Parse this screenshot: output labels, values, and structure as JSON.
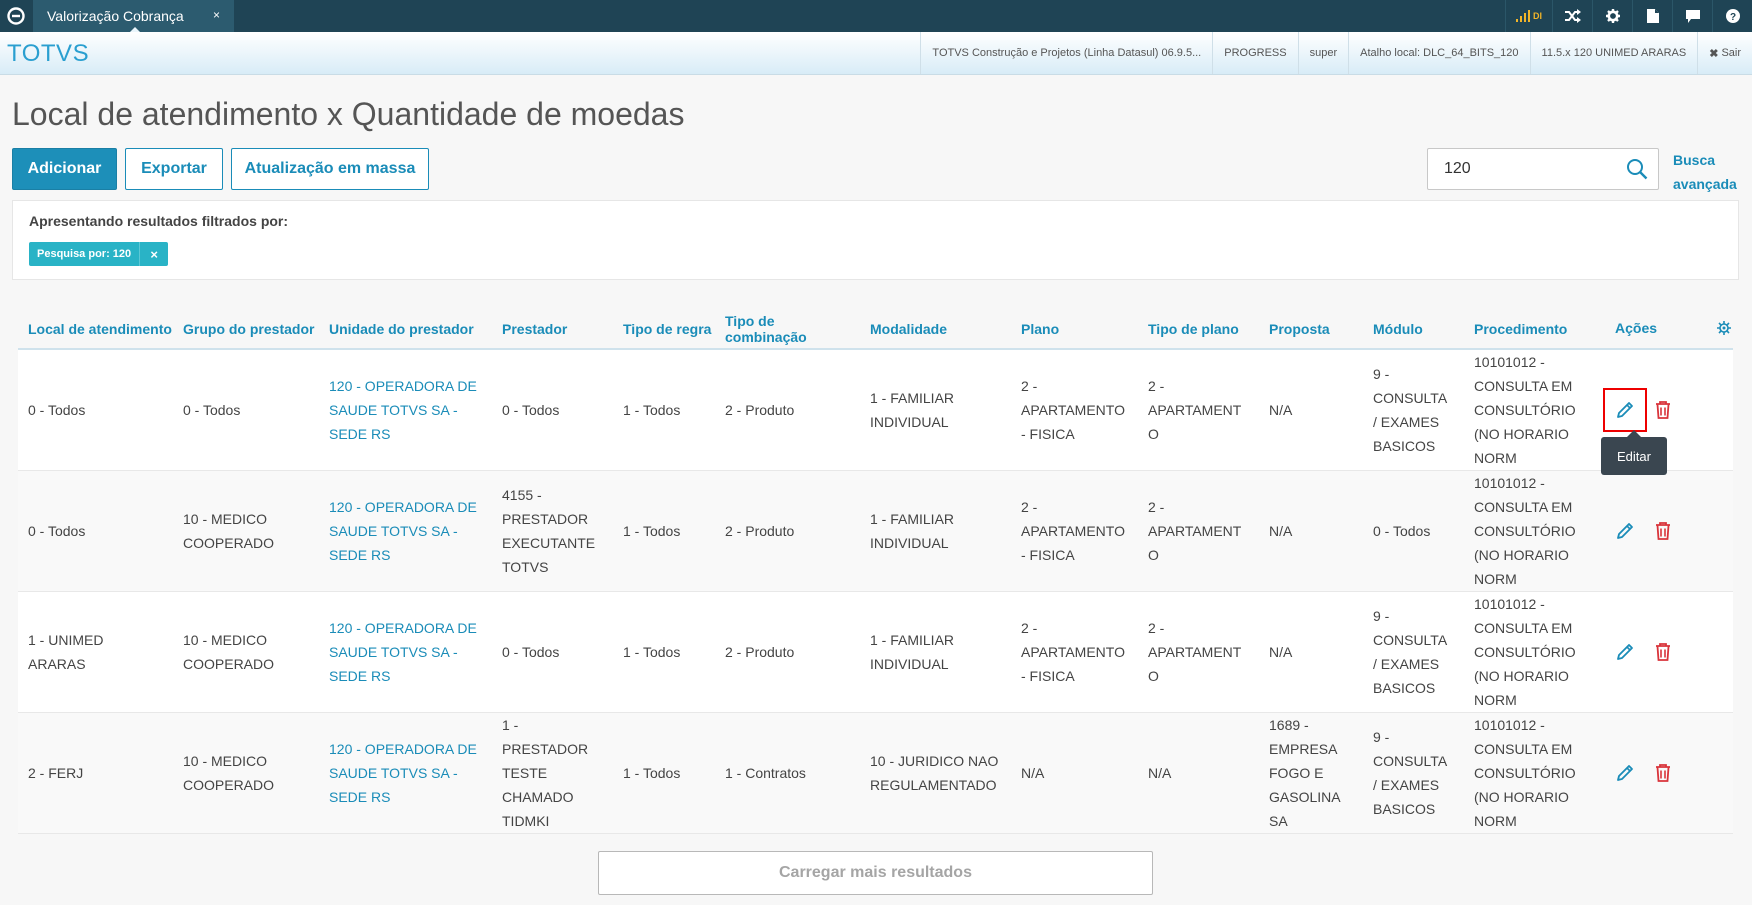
{
  "topbar": {
    "tab_label": "Valorização Cobrança",
    "tab_close": "×",
    "signal_text": "DI"
  },
  "header": {
    "brand": "TOTVS",
    "info": [
      "TOTVS Construção e Projetos (Linha Datasul) 06.9.5...",
      "PROGRESS",
      "super",
      "Atalho local: DLC_64_BITS_120",
      "11.5.x 120 UNIMED ARARAS"
    ],
    "logout": "Sair"
  },
  "page": {
    "title": "Local de atendimento x Quantidade de moedas"
  },
  "toolbar": {
    "add_label": "Adicionar",
    "export_label": "Exportar",
    "mass_update_label": "Atualização em massa",
    "search_value": "120",
    "advanced_search_label": "Busca avançada"
  },
  "filter": {
    "label": "Apresentando resultados filtrados por:",
    "chip_label": "Pesquisa por: 120",
    "chip_close": "×"
  },
  "table": {
    "columns": [
      "Local de atendimento",
      "Grupo do prestador",
      "Unidade do prestador",
      "Prestador",
      "Tipo de regra",
      "Tipo de combinação",
      "Modalidade",
      "Plano",
      "Tipo de plano",
      "Proposta",
      "Módulo",
      "Procedimento",
      "Ações"
    ],
    "rows": [
      [
        "0 - Todos",
        "0 - Todos",
        "120 - OPERADORA DE SAUDE TOTVS SA - SEDE RS",
        "0 - Todos",
        "1 - Todos",
        "2 - Produto",
        "1 - FAMILIAR INDIVIDUAL",
        "2 - APARTAMENTO - FISICA",
        "2 - APARTAMENTO",
        "N/A",
        "9 - CONSULTA / EXAMES BASICOS",
        "10101012 - CONSULTA EM CONSULTÓRIO (NO HORARIO NORM"
      ],
      [
        "0 - Todos",
        "10 - MEDICO COOPERADO",
        "120 - OPERADORA DE SAUDE TOTVS SA - SEDE RS",
        "4155 - PRESTADOR EXECUTANTE TOTVS",
        "1 - Todos",
        "2 - Produto",
        "1 - FAMILIAR INDIVIDUAL",
        "2 - APARTAMENTO - FISICA",
        "2 - APARTAMENTO",
        "N/A",
        "0 - Todos",
        "10101012 - CONSULTA EM CONSULTÓRIO (NO HORARIO NORM"
      ],
      [
        "1 - UNIMED ARARAS",
        "10 - MEDICO COOPERADO",
        "120 - OPERADORA DE SAUDE TOTVS SA - SEDE RS",
        "0 - Todos",
        "1 - Todos",
        "2 - Produto",
        "1 - FAMILIAR INDIVIDUAL",
        "2 - APARTAMENTO - FISICA",
        "2 - APARTAMENTO",
        "N/A",
        "9 - CONSULTA / EXAMES BASICOS",
        "10101012 - CONSULTA EM CONSULTÓRIO (NO HORARIO NORM"
      ],
      [
        "2 - FERJ",
        "10 - MEDICO COOPERADO",
        "120 - OPERADORA DE SAUDE TOTVS SA - SEDE RS",
        "1 - PRESTADOR TESTE CHAMADO TIDMKI",
        "1 - Todos",
        "1 - Contratos",
        "10 - JURIDICO NAO REGULAMENTADO",
        "N/A",
        "N/A",
        "1689 - EMPRESA FOGO E GASOLINA SA",
        "9 - CONSULTA / EXAMES BASICOS",
        "10101012 - CONSULTA EM CONSULTÓRIO (NO HORARIO NORM"
      ]
    ],
    "tooltip": "Editar",
    "load_more": "Carregar mais resultados"
  },
  "colors": {
    "topbar": "#1f4455",
    "accent": "#1a8cb8",
    "primary_button": "#1d8fb9",
    "chip": "#29b3c6",
    "delete": "#d9343b",
    "highlight": "#ee0000"
  }
}
